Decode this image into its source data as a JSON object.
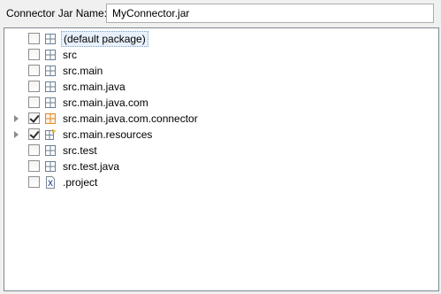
{
  "connector_jar": {
    "label": "Connector Jar Name:",
    "value": "MyConnector.jar"
  },
  "tree": {
    "items": [
      {
        "label": "(default package)",
        "checked": false,
        "expandable": false,
        "icon": "package-icon",
        "selected": true
      },
      {
        "label": "src",
        "checked": false,
        "expandable": false,
        "icon": "package-icon",
        "selected": false
      },
      {
        "label": "src.main",
        "checked": false,
        "expandable": false,
        "icon": "package-icon",
        "selected": false
      },
      {
        "label": "src.main.java",
        "checked": false,
        "expandable": false,
        "icon": "package-icon",
        "selected": false
      },
      {
        "label": "src.main.java.com",
        "checked": false,
        "expandable": false,
        "icon": "package-icon",
        "selected": false
      },
      {
        "label": "src.main.java.com.connector",
        "checked": true,
        "expandable": true,
        "icon": "package-orange-icon",
        "selected": false
      },
      {
        "label": "src.main.resources",
        "checked": true,
        "expandable": true,
        "icon": "resource-folder-icon",
        "selected": false
      },
      {
        "label": "src.test",
        "checked": false,
        "expandable": false,
        "icon": "package-icon",
        "selected": false
      },
      {
        "label": "src.test.java",
        "checked": false,
        "expandable": false,
        "icon": "package-icon",
        "selected": false
      },
      {
        "label": ".project",
        "checked": false,
        "expandable": false,
        "icon": "xml-file-icon",
        "selected": false
      }
    ]
  },
  "colors": {
    "package_icon": "#6a7f96",
    "package_orange_icon": "#e08a2c",
    "selection_border": "#7da2ce",
    "selection_fill": "#e8f1fb"
  }
}
